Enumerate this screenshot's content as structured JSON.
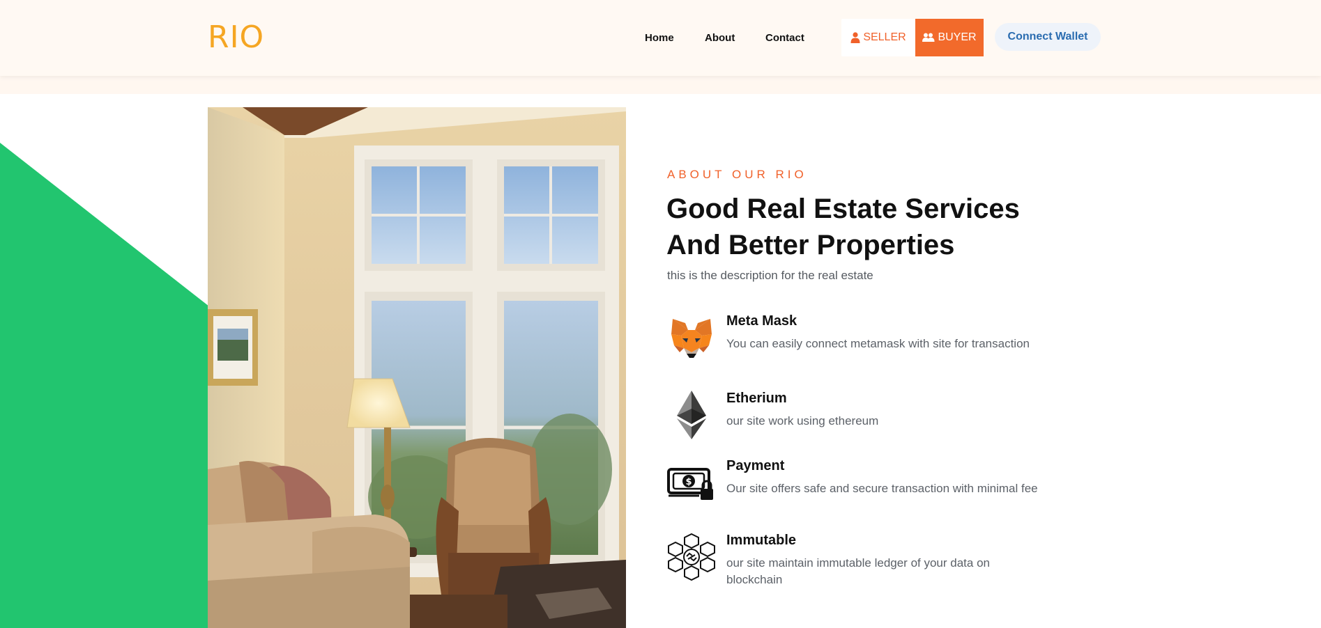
{
  "header": {
    "logo": "RIO",
    "nav": [
      {
        "label": "Home"
      },
      {
        "label": "About"
      },
      {
        "label": "Contact"
      }
    ],
    "seller_label": "SELLER",
    "buyer_label": "BUYER",
    "wallet_label": "Connect Wallet"
  },
  "about": {
    "eyebrow": "ABOUT OUR RIO",
    "title": "Good Real Estate Services And Better Properties",
    "description": "this is the description for the real estate"
  },
  "features": [
    {
      "icon": "metamask-fox-icon",
      "title": "Meta Mask",
      "text": "You can easily connect metamask with site for transaction"
    },
    {
      "icon": "ethereum-icon",
      "title": "Etherium",
      "text": "our site work using ethereum"
    },
    {
      "icon": "secure-payment-icon",
      "title": "Payment",
      "text": "Our site offers safe and secure transaction with minimal fee"
    },
    {
      "icon": "blockchain-icon",
      "title": "Immutable",
      "text": "our site maintain immutable ledger of your data on blockchain"
    }
  ],
  "colors": {
    "accent": "#f26a2b",
    "logo": "#f5a623",
    "green": "#22c56f",
    "wallet_text": "#2a6cb0",
    "header_bg": "#fff9f3"
  }
}
